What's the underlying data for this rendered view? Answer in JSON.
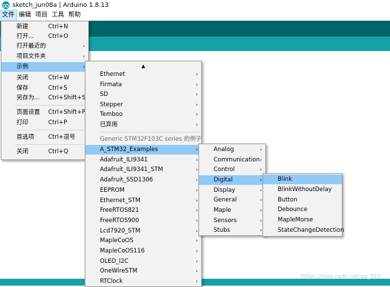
{
  "window": {
    "title": "sketch_jun08a | Arduino 1.8.13"
  },
  "menubar": {
    "items": [
      "文件",
      "编辑",
      "项目",
      "工具",
      "帮助"
    ]
  },
  "file_menu": {
    "items": [
      {
        "label": "新建",
        "shortcut": "Ctrl+N"
      },
      {
        "label": "打开...",
        "shortcut": "Ctrl+O"
      },
      {
        "label": "打开最近的",
        "arrow": "›"
      },
      {
        "label": "项目文件夹",
        "arrow": "›"
      },
      {
        "label": "示例",
        "arrow": "›"
      },
      {
        "label": "关闭",
        "shortcut": "Ctrl+W"
      },
      {
        "label": "保存",
        "shortcut": "Ctrl+S"
      },
      {
        "label": "另存为...",
        "shortcut": "Ctrl+Shift+S"
      },
      {
        "label": "页面设置",
        "shortcut": "Ctrl+Shift+P"
      },
      {
        "label": "打印",
        "shortcut": "Ctrl+P"
      },
      {
        "label": "首选项",
        "shortcut": "Ctrl+逗号"
      },
      {
        "label": "关闭",
        "shortcut": "Ctrl+Q"
      }
    ]
  },
  "examples_menu": {
    "scroll_up": "▲",
    "items": [
      "Ethernet",
      "Firmata",
      "SD",
      "Stepper",
      "Temboo",
      "已弃用",
      "Generic STM32F103C series 的例子",
      "A_STM32_Examples",
      "Adafruit_ILI9341",
      "Adafruit_ILI9341_STM",
      "Adafruit_SSD1306",
      "EEPROM",
      "Ethernet_STM",
      "FreeRTOS821",
      "FreeRTOS900",
      "Lcd7920_STM",
      "MapleCoOS",
      "MapleCoOS116",
      "OLED_I2C",
      "OneWireSTM",
      "RTClock"
    ],
    "arrow": "›"
  },
  "stm32_menu": {
    "items": [
      "Analog",
      "Communication",
      "Control",
      "Digital",
      "Display",
      "General",
      "Maple",
      "Sensors",
      "Stubs"
    ],
    "arrow": "›"
  },
  "digital_menu": {
    "items": [
      "Blink",
      "BlinkWithoutDelay",
      "Button",
      "Debounce",
      "MapleMorse",
      "StateChangeDetection"
    ]
  },
  "watermark": "https://blog.csdn.net/qq_322..."
}
